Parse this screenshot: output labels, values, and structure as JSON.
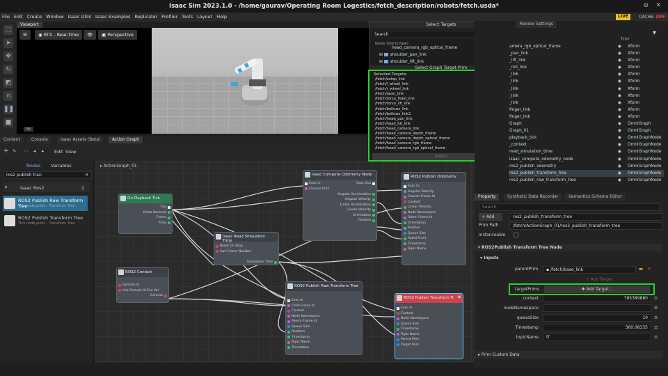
{
  "window": {
    "title": "Isaac Sim 2023.1.0 - /home/gaurav/Operating Room Logestics/fetch_description/robots/fetch.usda*"
  },
  "menu": [
    "File",
    "Edit",
    "Create",
    "Window",
    "Isaac Utils",
    "Isaac Examples",
    "Replicator",
    "Profiler",
    "Tools",
    "Layout",
    "Help"
  ],
  "status": {
    "live": "LIVE",
    "cache": "CACHE:",
    "cache_state": "OFF"
  },
  "viewport": {
    "tab": "Viewport",
    "renderer": "RTX - Real-Time",
    "camera": "Perspective",
    "unit": "m"
  },
  "bottom_tabs": [
    "Content",
    "Console",
    "Isaac Assets (Beta)",
    "Action Graph"
  ],
  "graph_toolbar": {
    "edit": "Edit",
    "view": "View",
    "nodes": "Nodes",
    "variables": "Variables",
    "search": "ros2 publish tran"
  },
  "node_list": {
    "group": "Isaac Ros2",
    "count": "2",
    "items": [
      {
        "name": "ROS2 Publish Raw Transform Tree",
        "desc": "This node publi... Transform Tree"
      },
      {
        "name": "ROS2 Publish Transform Tree",
        "desc": "This node publi... Transform Tree"
      }
    ]
  },
  "graph": {
    "path": "ActionGraph_01"
  },
  "nodes": {
    "tick": {
      "title": "On Playback Tick",
      "outputs": [
        "Tick",
        "Delta Seconds",
        "Frame",
        "Time"
      ]
    },
    "odom": {
      "title": "Isaac Compute Odometry Node",
      "inputs": [
        "Exec In",
        "Chassis Prim"
      ],
      "outputs": [
        "Exec Out",
        "Angular Acceleration",
        "Angular Velocity",
        "Linear Acceleration",
        "Linear Velocity",
        "Orientation",
        "Position"
      ]
    },
    "pubodom": {
      "title": "ROS2 Publish Odometry",
      "inputs": [
        "Exec In",
        "Angular Velocity",
        "Chassis Frame Id",
        "Context",
        "Linear Velocity",
        "Node Namespace",
        "Odom Frame Id",
        "Orientation",
        "Position",
        "Queue Size",
        "Robot Front",
        "Timestamp",
        "Topic Name"
      ]
    },
    "simtime": {
      "title": "Isaac Read Simulation Time",
      "inputs": [
        "Reset On Stop",
        "Swh Frame Number"
      ],
      "outputs": [
        "Simulation Time"
      ]
    },
    "context": {
      "title": "ROS2 Context",
      "inputs": [
        "Domain Id",
        "Use Domain Id Env Var"
      ],
      "outputs": [
        "Context"
      ]
    },
    "raw": {
      "title": "ROS2 Publish Raw Transform Tree",
      "inputs": [
        "Exec In",
        "Child Frame Id",
        "Context",
        "Node Namespace",
        "Parent Frame Id",
        "Queue Size",
        "Rotation",
        "Timestamp",
        "Topic Name",
        "Translation"
      ]
    },
    "tf": {
      "title": "ROS2 Publish Transform Tr",
      "inputs": [
        "Exec In",
        "Context",
        "Node Namespace",
        "Queue Size",
        "Timestamp",
        "Topic Name",
        "Parent Prim",
        "Target Prim"
      ]
    }
  },
  "select_targets": {
    "title": "Select Targets",
    "search": "Search",
    "col_name": "Name (Old to New)",
    "col_type": "Type",
    "rows": [
      {
        "name": "head_camera_rgb_optical_frame",
        "type": "Xform"
      },
      {
        "name": "shoulder_pan_link",
        "type": "Xform"
      },
      {
        "name": "shoulder_lift_link",
        "type": "Xform"
      }
    ],
    "graph_target": "Select Graph Target Prim",
    "selected_label": "Selected Targets:",
    "selected": [
      "/fetch/estop_link",
      "/fetch/l_wheel_link",
      "/fetch/r_wheel_link",
      "/fetch/laser_link",
      "/fetch/torso_fixed_link",
      "/fetch/torso_lift_link",
      "/fetch/bellows_link",
      "/fetch/bellows_link2",
      "/fetch/head_pan_link",
      "/fetch/head_tilt_link",
      "/fetch/head_camera_link",
      "/fetch/head_camera_depth_frame",
      "/fetch/head_camera_depth_optical_frame",
      "/fetch/head_camera_rgb_frame",
      "/fetch/head_camera_rgb_optical_frame"
    ],
    "select_btn": "Select"
  },
  "stage": {
    "tab": "Render Settings",
    "col_type": "Type",
    "rows": [
      {
        "name": "amera_rgb_optical_frame",
        "type": "Xform"
      },
      {
        "name": "_pan_link",
        "type": "Xform"
      },
      {
        "name": "_lift_link",
        "type": "Xform"
      },
      {
        "name": "_roll_link",
        "type": "Xform"
      },
      {
        "name": "_link",
        "type": "Xform"
      },
      {
        "name": "_link",
        "type": "Xform"
      },
      {
        "name": "_link",
        "type": "Xform"
      },
      {
        "name": "_link",
        "type": "Xform"
      },
      {
        "name": "_link",
        "type": "Xform"
      },
      {
        "name": "finger_link",
        "type": "Xform"
      },
      {
        "name": "finger_link",
        "type": "Xform"
      },
      {
        "name": "Graph",
        "type": "OmniGraph"
      },
      {
        "name": "Graph_01",
        "type": "OmniGraph"
      },
      {
        "name": "playback_tick",
        "type": "OmniGraphNode"
      },
      {
        "name": "_context",
        "type": "OmniGraphNode"
      },
      {
        "name": "read_simulation_time",
        "type": "OmniGraphNode"
      },
      {
        "name": "isaac_compute_odometry_node",
        "type": "OmniGraphNode"
      },
      {
        "name": "ros2_publish_odometry",
        "type": "OmniGraphNode"
      },
      {
        "name": "ros2_publish_transform_tree",
        "type": "OmniGraphNode"
      },
      {
        "name": "ros2_publish_raw_transform_tree",
        "type": "OmniGraphNode"
      }
    ]
  },
  "property": {
    "tabs": [
      "Property",
      "Synthetic Data Recorder",
      "Semantics Schema Editor"
    ],
    "search": "Search",
    "add": "Add",
    "prim_name": "ros2_publish_transform_tree",
    "prim_path_label": "Prim Path",
    "prim_path": "/fetch/ActionGraph_01/ros2_publish_transform_tree",
    "instanceable": "Instanceable",
    "section": "ROS2Publish Transform Tree Node",
    "inputs": "Inputs",
    "parent_prim_label": "parentPrim",
    "parent_prim": "/fetch/base_link",
    "add_target": "Add Target",
    "target_prim_label": "targetPrims",
    "add_target_btn": "Add Target...",
    "fields": [
      {
        "label": "context",
        "value": "785389880"
      },
      {
        "label": "nodeNamespace",
        "value": ""
      },
      {
        "label": "queueSize",
        "value": "10"
      },
      {
        "label": "Timestamp",
        "value": "360.08335"
      },
      {
        "label": "topicName",
        "value": "tf"
      }
    ],
    "custom": "Prim Custom Data"
  }
}
